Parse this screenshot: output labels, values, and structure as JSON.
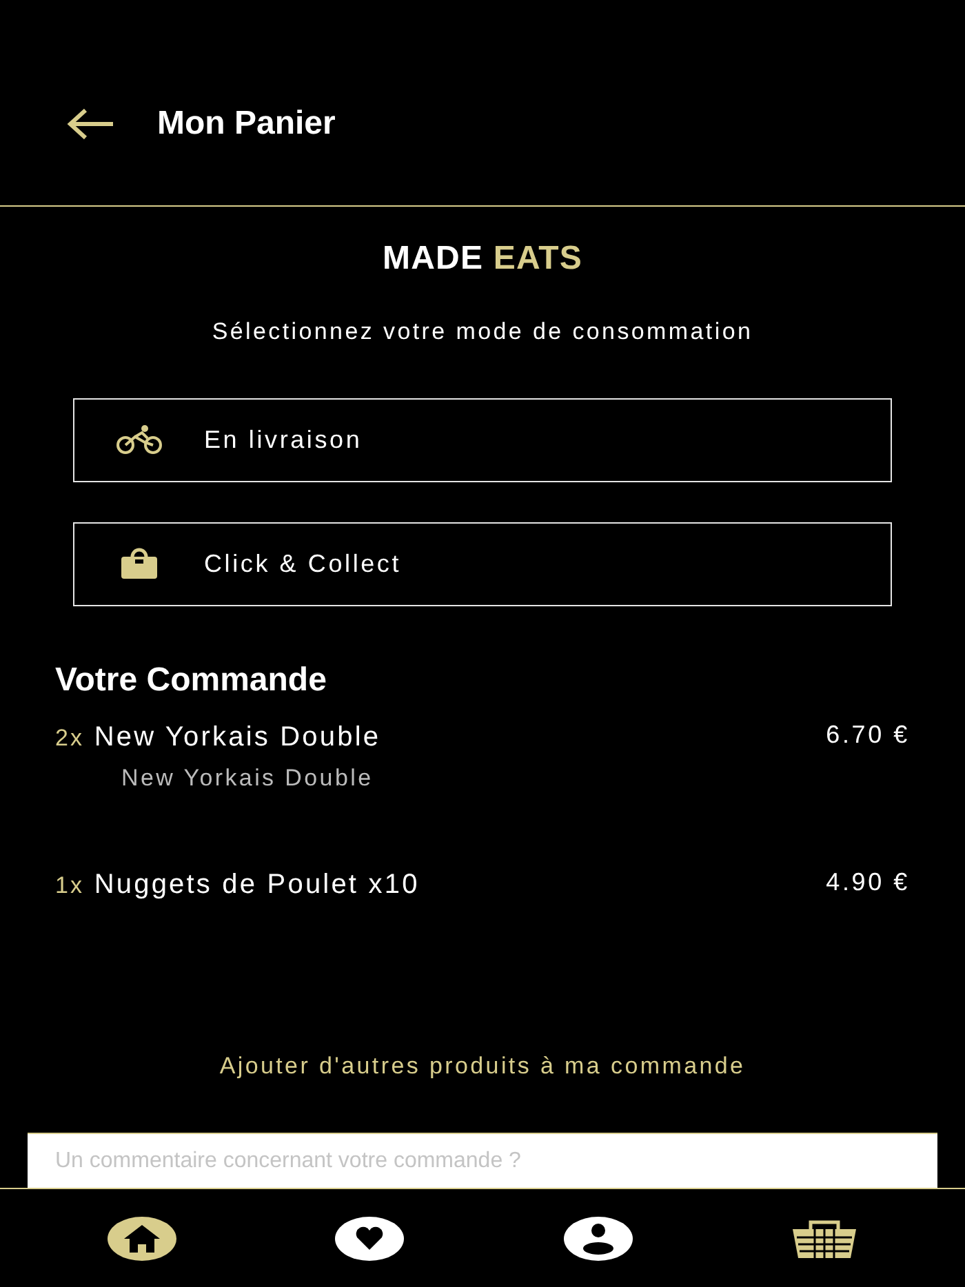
{
  "header": {
    "title": "Mon Panier"
  },
  "brand": {
    "part_1": "MADE",
    "part_2": "EATS"
  },
  "prompt": "Sélectionnez votre mode de consommation",
  "modes": [
    {
      "kind": "bike",
      "label": "En livraison"
    },
    {
      "kind": "bag",
      "label": "Click & Collect"
    }
  ],
  "order": {
    "title": "Votre Commande",
    "items": [
      {
        "quantity": "2x",
        "name": "New Yorkais Double",
        "detail": "New Yorkais Double",
        "price": "6.70 €"
      },
      {
        "quantity": "1x",
        "name": "Nuggets de Poulet x10",
        "price": "4.90 €"
      }
    ]
  },
  "add_link": "Ajouter d'autres produits à ma commande",
  "comment": {
    "placeholder": "Un commentaire concernant votre commande ?"
  },
  "nav": [
    {
      "kind": "home",
      "color": "#d8cd8c"
    },
    {
      "kind": "heart",
      "color": "#ffffff"
    },
    {
      "kind": "user",
      "color": "#ffffff"
    },
    {
      "kind": "basket",
      "color": "#d8cd8c"
    }
  ]
}
